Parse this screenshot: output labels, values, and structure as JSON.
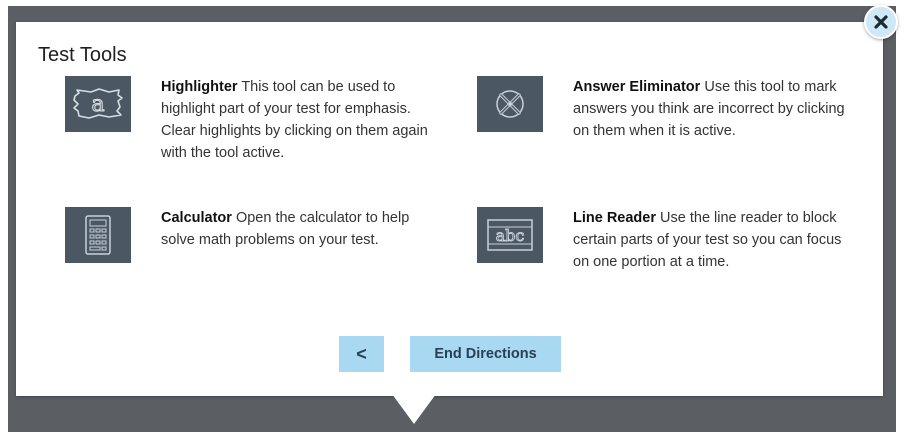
{
  "dialog": {
    "title": "Test Tools",
    "close_icon": "close-icon"
  },
  "tools": [
    {
      "name": "Highlighter",
      "description": "This tool can be used to highlight part of your test for emphasis. Clear highlights by clicking on them again with the tool active.",
      "icon": "highlighter-icon"
    },
    {
      "name": "Answer Eliminator",
      "description": "Use this tool to mark answers you think are incorrect by clicking on them when it is active.",
      "icon": "answer-eliminator-icon"
    },
    {
      "name": "Calculator",
      "description": "Open the calculator to help solve math problems on your test.",
      "icon": "calculator-icon"
    },
    {
      "name": "Line Reader",
      "description": "Use the line reader to block certain parts of your test so you can focus on one portion at a time.",
      "icon": "line-reader-icon",
      "icon_text": "abc"
    }
  ],
  "nav": {
    "back_icon": "chevron-left-icon",
    "back_glyph": "<",
    "end_label": "End Directions"
  },
  "colors": {
    "backdrop": "#5b5e62",
    "icon_bg": "#4b5864",
    "button_bg": "#a8d8f2",
    "close_bg": "#cfe8f7"
  }
}
